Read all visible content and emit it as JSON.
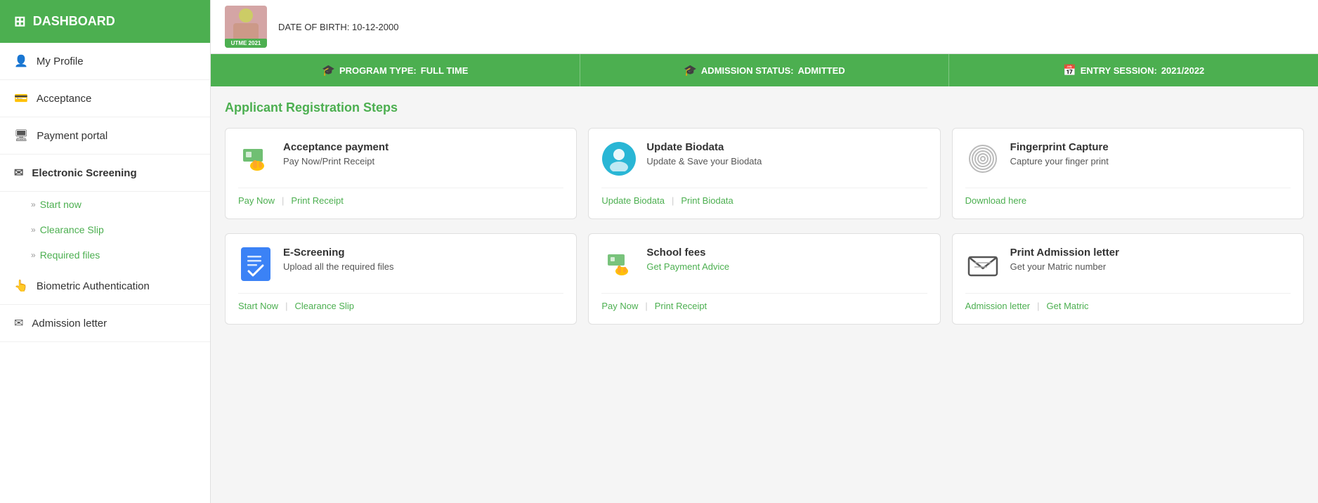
{
  "sidebar": {
    "dashboard_label": "DASHBOARD",
    "items": [
      {
        "id": "my-profile",
        "label": "My Profile",
        "icon": "👤"
      },
      {
        "id": "acceptance",
        "label": "Acceptance",
        "icon": "💳"
      },
      {
        "id": "payment-portal",
        "label": "Payment portal",
        "icon": "🖥"
      },
      {
        "id": "electronic-screening",
        "label": "Electronic Screening",
        "icon": "✉",
        "active": true
      },
      {
        "id": "biometric-authentication",
        "label": "Biometric Authentication",
        "icon": "👆"
      },
      {
        "id": "admission-letter",
        "label": "Admission letter",
        "icon": "✉"
      }
    ],
    "sub_items": [
      {
        "id": "start-now",
        "label": "Start now"
      },
      {
        "id": "clearance-slip",
        "label": "Clearance Slip"
      },
      {
        "id": "required-files",
        "label": "Required files"
      }
    ]
  },
  "status_bar": {
    "program_type_label": "PROGRAM TYPE:",
    "program_type_value": "FULL TIME",
    "admission_status_label": "ADMISSION STATUS:",
    "admission_status_value": "ADMITTED",
    "entry_session_label": "ENTRY SESSION:",
    "entry_session_value": "2021/2022"
  },
  "registration": {
    "section_title": "Applicant Registration Steps",
    "cards": [
      {
        "id": "acceptance-payment",
        "title": "Acceptance payment",
        "subtitle": "Pay Now/Print Receipt",
        "actions": [
          {
            "id": "pay-now",
            "label": "Pay Now"
          },
          {
            "id": "print-receipt",
            "label": "Print Receipt"
          }
        ]
      },
      {
        "id": "update-biodata",
        "title": "Update Biodata",
        "subtitle": "Update & Save your Biodata",
        "actions": [
          {
            "id": "update-biodata-link",
            "label": "Update Biodata"
          },
          {
            "id": "print-biodata",
            "label": "Print Biodata"
          }
        ]
      },
      {
        "id": "fingerprint-capture",
        "title": "Fingerprint Capture",
        "subtitle": "Capture your finger print",
        "actions": [
          {
            "id": "download-here",
            "label": "Download here"
          }
        ]
      },
      {
        "id": "e-screening",
        "title": "E-Screening",
        "subtitle": "Upload all the required files",
        "actions": [
          {
            "id": "start-now-btn",
            "label": "Start Now"
          },
          {
            "id": "clearance-slip-btn",
            "label": "Clearance Slip"
          }
        ]
      },
      {
        "id": "school-fees",
        "title": "School fees",
        "subtitle": "Get Payment Advice",
        "actions": [
          {
            "id": "school-pay-now",
            "label": "Pay Now"
          },
          {
            "id": "school-print-receipt",
            "label": "Print Receipt"
          }
        ]
      },
      {
        "id": "print-admission",
        "title": "Print Admission letter",
        "subtitle": "Get your Matric number",
        "actions": [
          {
            "id": "admission-letter-link",
            "label": "Admission letter"
          },
          {
            "id": "get-matric",
            "label": "Get Matric"
          }
        ]
      }
    ]
  },
  "profile": {
    "utme_badge": "UTME 2021",
    "date_of_birth": "DATE OF BIRTH: 10-12-2000"
  }
}
